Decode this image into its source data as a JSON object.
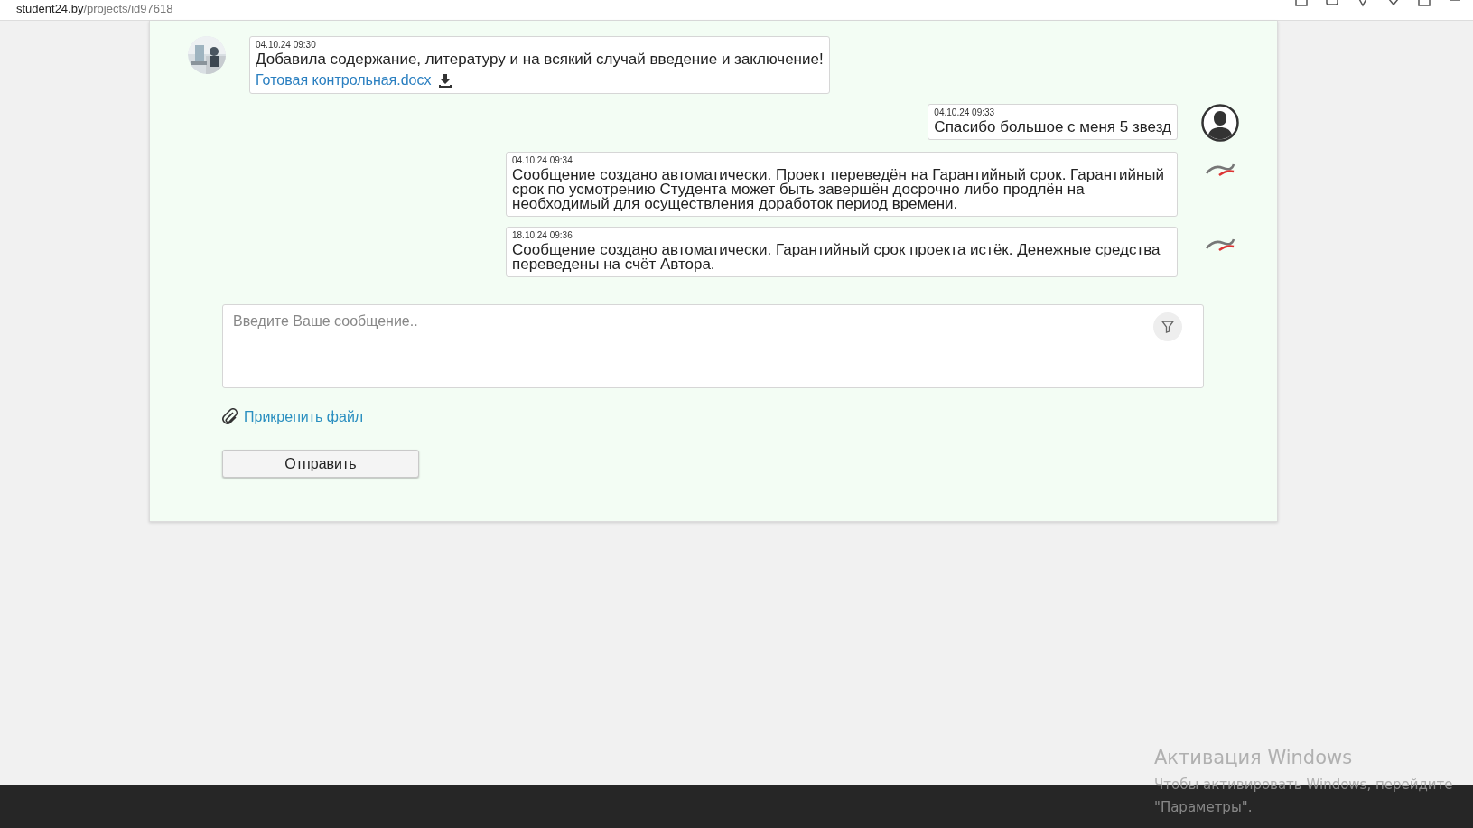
{
  "browser": {
    "url_host": "student24.by",
    "url_path": "/projects/id97618"
  },
  "messages": [
    {
      "kind": "author",
      "time": "04.10.24 09:30",
      "text": "Добавила содержание, литературу и на всякий случай введение и заключение!",
      "attachment": "Готовая контрольная.docx"
    },
    {
      "kind": "customer",
      "time": "04.10.24 09:33",
      "text": "Спасибо большое с меня 5 звезд"
    },
    {
      "kind": "system",
      "time": "04.10.24 09:34",
      "text": "Сообщение создано автоматически. Проект переведён на Гарантийный срок. Гарантийный срок по усмотрению Студента может быть завершён досрочно либо продлён на необходимый для осуществления доработок период времени."
    },
    {
      "kind": "system",
      "time": "18.10.24 09:36",
      "text": "Сообщение создано автоматически. Гарантийный срок проекта истёк. Денежные средства переведены на счёт Автора."
    }
  ],
  "composer": {
    "placeholder": "Введите Ваше сообщение..",
    "attach_label": "Прикрепить файл",
    "send_button": "Отправить"
  },
  "os_overlay": {
    "title": "Активация Windows",
    "line_1": "Чтобы активировать Windows, перейдите",
    "line_2": "\"Параметры\"."
  }
}
